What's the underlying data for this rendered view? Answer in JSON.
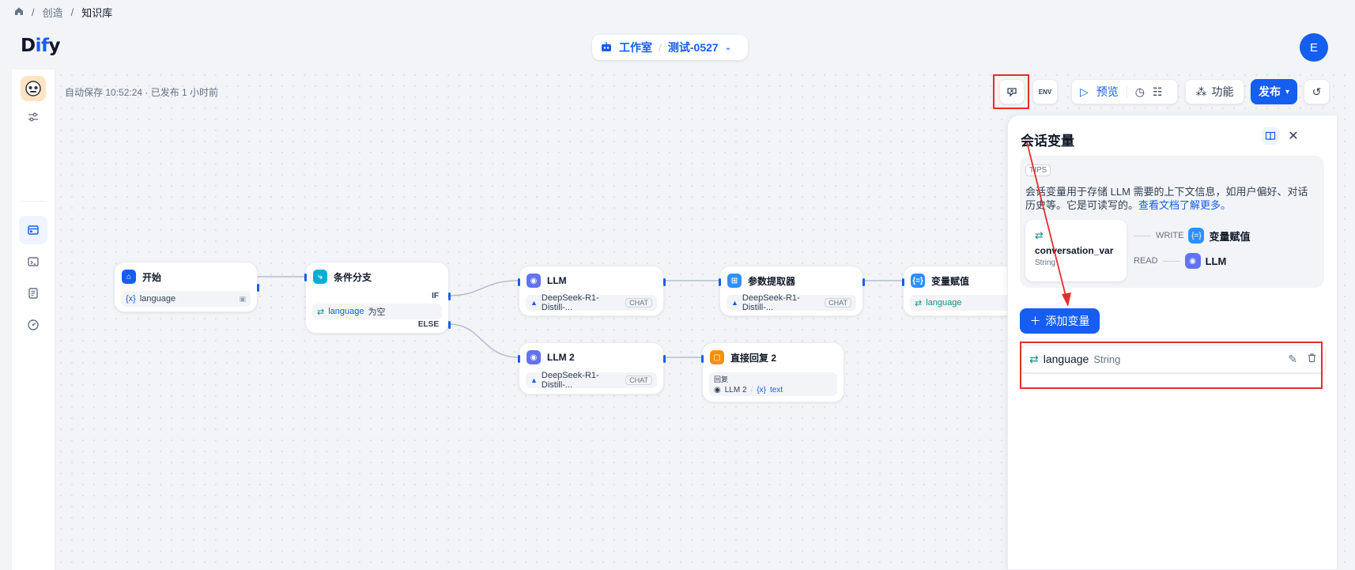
{
  "breadcrumb": {
    "items": [
      "创造",
      "知识库"
    ]
  },
  "header": {
    "logo_a": "D",
    "logo_b": "if",
    "logo_c": "y",
    "studio": "工作室",
    "app_name": "测试-0527",
    "avatar": "E"
  },
  "canvas": {
    "autosave": "自动保存 10:52:24 · 已发布 1 小时前"
  },
  "toolbar": {
    "env": "ENV",
    "preview": "预览",
    "features": "功能",
    "publish": "发布"
  },
  "nodes": {
    "start": {
      "title": "开始",
      "var": "language"
    },
    "branch": {
      "title": "条件分支",
      "if": "IF",
      "else": "ELSE",
      "cond_var": "language",
      "cond_op": "为空"
    },
    "llm": {
      "title": "LLM",
      "model": "DeepSeek-R1-Distill-...",
      "tag": "CHAT"
    },
    "param": {
      "title": "参数提取器",
      "model": "DeepSeek-R1-Distill-...",
      "tag": "CHAT"
    },
    "assign": {
      "title": "变量赋值",
      "var": "language"
    },
    "llm2": {
      "title": "LLM 2",
      "model": "DeepSeek-R1-Distill-...",
      "tag": "CHAT"
    },
    "reply": {
      "title": "直接回复 2",
      "label": "回复",
      "src": "LLM 2",
      "field": "text"
    }
  },
  "panel": {
    "title": "会话变量",
    "tips_badge": "TIPS",
    "tips_text": "会话变量用于存储 LLM 需要的上下文信息，如用户偏好、对话历史等。它是可读写的。",
    "tips_link": "查看文档了解更多。",
    "card_name": "conversation_var",
    "card_type": "String",
    "write": "WRITE",
    "read": "READ",
    "write_target": "变量赋值",
    "read_target": "LLM",
    "add_button": "添加变量",
    "variables": [
      {
        "name": "language",
        "type": "String"
      }
    ]
  },
  "colors": {
    "accent": "#155eef",
    "highlight": "#e62e2e"
  }
}
